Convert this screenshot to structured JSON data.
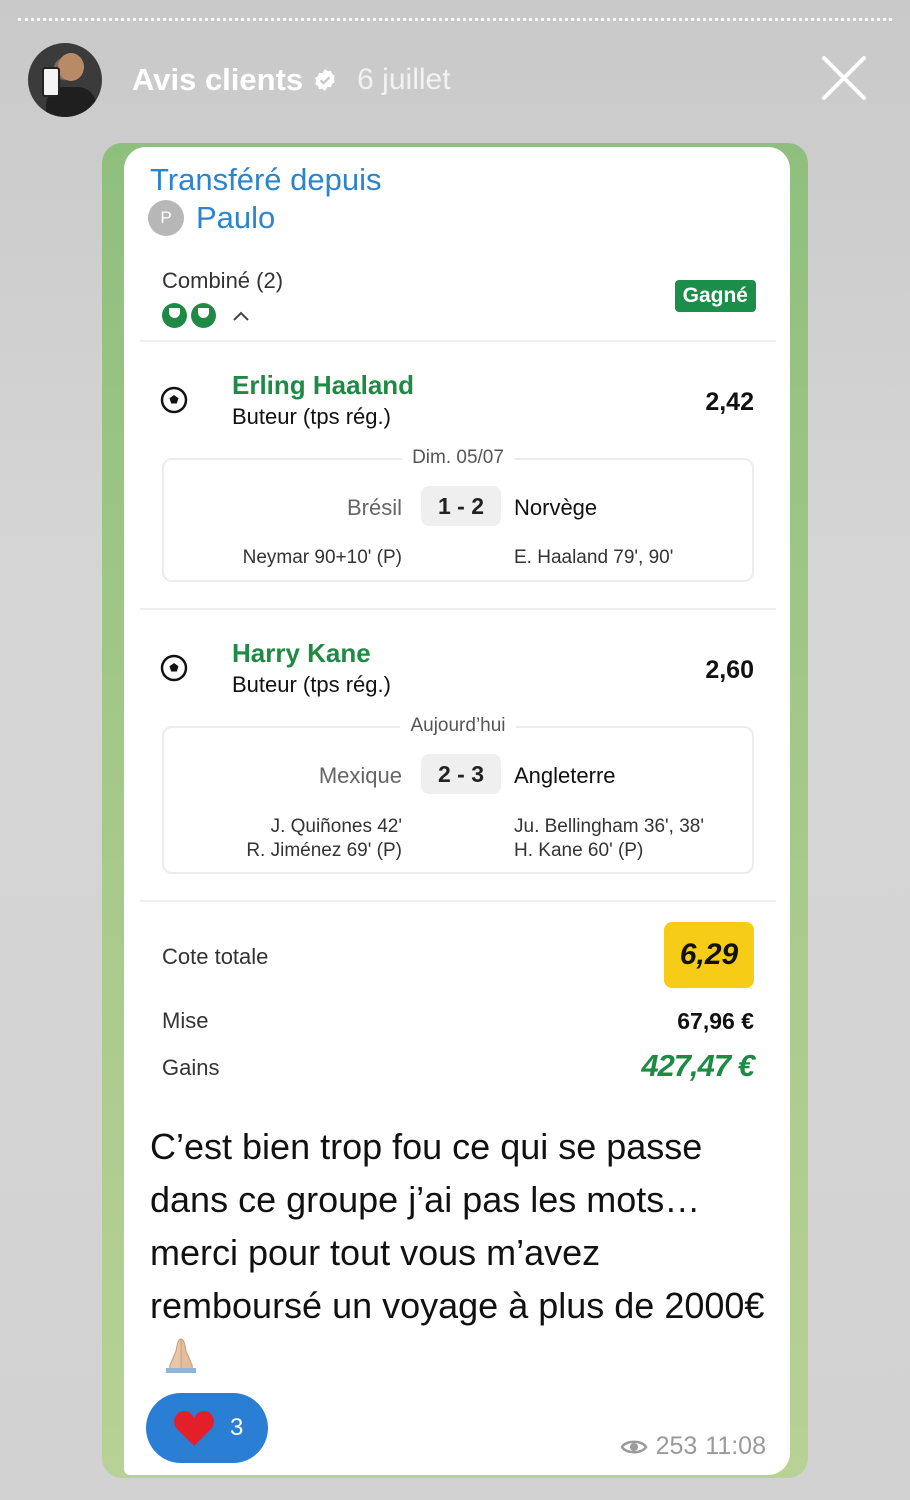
{
  "story": {
    "name": "Avis clients",
    "date": "6 juillet"
  },
  "forward": {
    "title": "Transféré depuis",
    "from_initial": "P",
    "from_name": "Paulo"
  },
  "bet": {
    "type_label": "Combiné (2)",
    "status": "Gagné",
    "legs": [
      {
        "player": "Erling Haaland",
        "market": "Buteur (tps rég.)",
        "odd": "2,42",
        "date": "Dim. 05/07",
        "home": "Brésil",
        "score": "1 - 2",
        "away": "Norvège",
        "home_scorers": [
          "Neymar 90+10' (P)"
        ],
        "away_scorers": [
          "E. Haaland 79', 90'"
        ]
      },
      {
        "player": "Harry Kane",
        "market": "Buteur (tps rég.)",
        "odd": "2,60",
        "date": "Aujourd’hui",
        "home": "Mexique",
        "score": "2 - 3",
        "away": "Angleterre",
        "home_scorers": [
          "J. Quiñones 42'",
          "R. Jiménez 69' (P)"
        ],
        "away_scorers": [
          "Ju. Bellingham 36', 38'",
          "H. Kane 60' (P)"
        ]
      }
    ],
    "total_label": "Cote totale",
    "total_odd": "6,29",
    "stake_label": "Mise",
    "stake": "67,96 €",
    "gains_label": "Gains",
    "gains": "427,47 €"
  },
  "message": {
    "text": "C’est bien trop fou ce qui se passe dans ce groupe j’ai pas les mots… merci pour tout vous m’avez remboursé un voyage à plus de 2000€"
  },
  "reaction": {
    "count": "3"
  },
  "footer": {
    "views": "253",
    "time": "11:08"
  },
  "colors": {
    "accent_green": "#1f8a44",
    "link_blue": "#2c84d1",
    "total_yellow": "#f7cc16",
    "reaction_blue": "#2a7fd4"
  }
}
